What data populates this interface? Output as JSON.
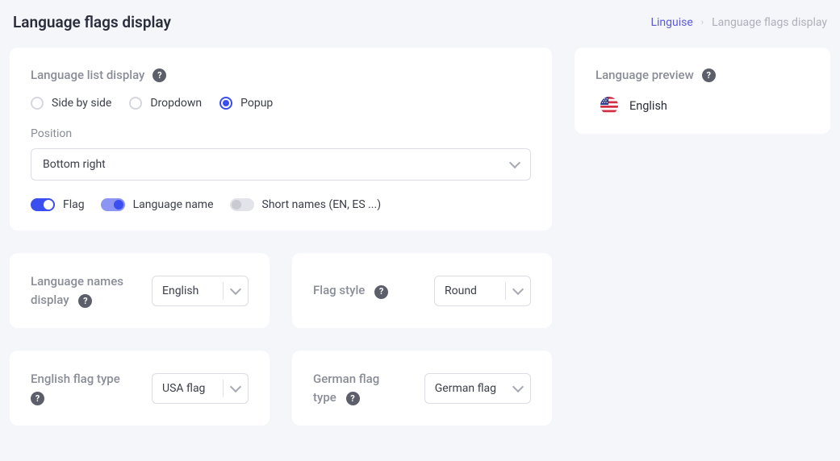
{
  "page": {
    "title": "Language flags display"
  },
  "breadcrumb": {
    "root": "Linguise",
    "current": "Language flags display"
  },
  "main": {
    "listTitle": "Language list display",
    "radios": {
      "side": "Side by side",
      "dropdown": "Dropdown",
      "popup": "Popup",
      "selected": "popup"
    },
    "positionLabel": "Position",
    "positionValue": "Bottom right",
    "toggles": {
      "flag": "Flag",
      "langName": "Language name",
      "shortNames": "Short names (EN, ES ...)"
    }
  },
  "cards": {
    "namesDisplay": {
      "title": "Language names display",
      "value": "English"
    },
    "flagStyle": {
      "title": "Flag style",
      "value": "Round"
    },
    "englishFlag": {
      "title": "English flag type",
      "value": "USA flag"
    },
    "germanFlag": {
      "title": "German flag type",
      "value": "German flag"
    }
  },
  "preview": {
    "title": "Language preview",
    "lang": "English"
  }
}
